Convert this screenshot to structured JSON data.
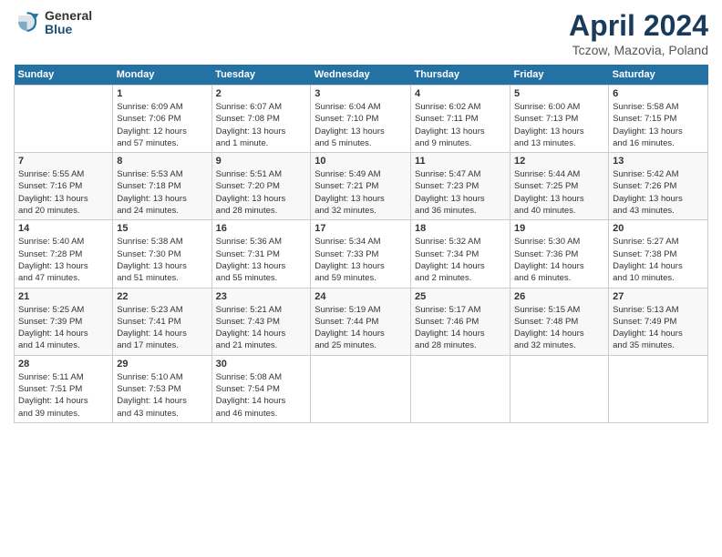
{
  "header": {
    "logo_general": "General",
    "logo_blue": "Blue",
    "title": "April 2024",
    "location": "Tczow, Mazovia, Poland"
  },
  "calendar": {
    "headers": [
      "Sunday",
      "Monday",
      "Tuesday",
      "Wednesday",
      "Thursday",
      "Friday",
      "Saturday"
    ],
    "weeks": [
      [
        {
          "day": "",
          "info": ""
        },
        {
          "day": "1",
          "info": "Sunrise: 6:09 AM\nSunset: 7:06 PM\nDaylight: 12 hours\nand 57 minutes."
        },
        {
          "day": "2",
          "info": "Sunrise: 6:07 AM\nSunset: 7:08 PM\nDaylight: 13 hours\nand 1 minute."
        },
        {
          "day": "3",
          "info": "Sunrise: 6:04 AM\nSunset: 7:10 PM\nDaylight: 13 hours\nand 5 minutes."
        },
        {
          "day": "4",
          "info": "Sunrise: 6:02 AM\nSunset: 7:11 PM\nDaylight: 13 hours\nand 9 minutes."
        },
        {
          "day": "5",
          "info": "Sunrise: 6:00 AM\nSunset: 7:13 PM\nDaylight: 13 hours\nand 13 minutes."
        },
        {
          "day": "6",
          "info": "Sunrise: 5:58 AM\nSunset: 7:15 PM\nDaylight: 13 hours\nand 16 minutes."
        }
      ],
      [
        {
          "day": "7",
          "info": "Sunrise: 5:55 AM\nSunset: 7:16 PM\nDaylight: 13 hours\nand 20 minutes."
        },
        {
          "day": "8",
          "info": "Sunrise: 5:53 AM\nSunset: 7:18 PM\nDaylight: 13 hours\nand 24 minutes."
        },
        {
          "day": "9",
          "info": "Sunrise: 5:51 AM\nSunset: 7:20 PM\nDaylight: 13 hours\nand 28 minutes."
        },
        {
          "day": "10",
          "info": "Sunrise: 5:49 AM\nSunset: 7:21 PM\nDaylight: 13 hours\nand 32 minutes."
        },
        {
          "day": "11",
          "info": "Sunrise: 5:47 AM\nSunset: 7:23 PM\nDaylight: 13 hours\nand 36 minutes."
        },
        {
          "day": "12",
          "info": "Sunrise: 5:44 AM\nSunset: 7:25 PM\nDaylight: 13 hours\nand 40 minutes."
        },
        {
          "day": "13",
          "info": "Sunrise: 5:42 AM\nSunset: 7:26 PM\nDaylight: 13 hours\nand 43 minutes."
        }
      ],
      [
        {
          "day": "14",
          "info": "Sunrise: 5:40 AM\nSunset: 7:28 PM\nDaylight: 13 hours\nand 47 minutes."
        },
        {
          "day": "15",
          "info": "Sunrise: 5:38 AM\nSunset: 7:30 PM\nDaylight: 13 hours\nand 51 minutes."
        },
        {
          "day": "16",
          "info": "Sunrise: 5:36 AM\nSunset: 7:31 PM\nDaylight: 13 hours\nand 55 minutes."
        },
        {
          "day": "17",
          "info": "Sunrise: 5:34 AM\nSunset: 7:33 PM\nDaylight: 13 hours\nand 59 minutes."
        },
        {
          "day": "18",
          "info": "Sunrise: 5:32 AM\nSunset: 7:34 PM\nDaylight: 14 hours\nand 2 minutes."
        },
        {
          "day": "19",
          "info": "Sunrise: 5:30 AM\nSunset: 7:36 PM\nDaylight: 14 hours\nand 6 minutes."
        },
        {
          "day": "20",
          "info": "Sunrise: 5:27 AM\nSunset: 7:38 PM\nDaylight: 14 hours\nand 10 minutes."
        }
      ],
      [
        {
          "day": "21",
          "info": "Sunrise: 5:25 AM\nSunset: 7:39 PM\nDaylight: 14 hours\nand 14 minutes."
        },
        {
          "day": "22",
          "info": "Sunrise: 5:23 AM\nSunset: 7:41 PM\nDaylight: 14 hours\nand 17 minutes."
        },
        {
          "day": "23",
          "info": "Sunrise: 5:21 AM\nSunset: 7:43 PM\nDaylight: 14 hours\nand 21 minutes."
        },
        {
          "day": "24",
          "info": "Sunrise: 5:19 AM\nSunset: 7:44 PM\nDaylight: 14 hours\nand 25 minutes."
        },
        {
          "day": "25",
          "info": "Sunrise: 5:17 AM\nSunset: 7:46 PM\nDaylight: 14 hours\nand 28 minutes."
        },
        {
          "day": "26",
          "info": "Sunrise: 5:15 AM\nSunset: 7:48 PM\nDaylight: 14 hours\nand 32 minutes."
        },
        {
          "day": "27",
          "info": "Sunrise: 5:13 AM\nSunset: 7:49 PM\nDaylight: 14 hours\nand 35 minutes."
        }
      ],
      [
        {
          "day": "28",
          "info": "Sunrise: 5:11 AM\nSunset: 7:51 PM\nDaylight: 14 hours\nand 39 minutes."
        },
        {
          "day": "29",
          "info": "Sunrise: 5:10 AM\nSunset: 7:53 PM\nDaylight: 14 hours\nand 43 minutes."
        },
        {
          "day": "30",
          "info": "Sunrise: 5:08 AM\nSunset: 7:54 PM\nDaylight: 14 hours\nand 46 minutes."
        },
        {
          "day": "",
          "info": ""
        },
        {
          "day": "",
          "info": ""
        },
        {
          "day": "",
          "info": ""
        },
        {
          "day": "",
          "info": ""
        }
      ]
    ]
  }
}
